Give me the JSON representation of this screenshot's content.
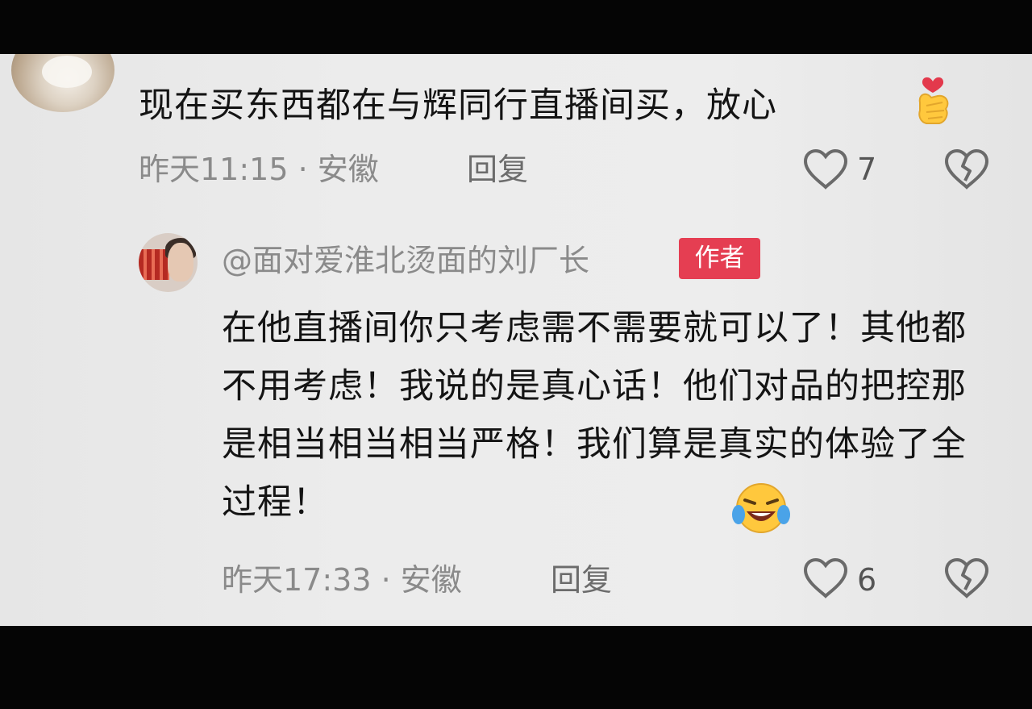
{
  "comments": [
    {
      "text": "现在买东西都在与辉同行直播间买，放心",
      "time_location": "昨天11:15 · 安徽",
      "reply_label": "回复",
      "likes": "7",
      "emoji": "finger-heart-emoji"
    },
    {
      "username": "@面对爱淮北烫面的刘厂长",
      "badge": "作者",
      "text": "在他直播间你只考虑需不需要就可以了！其他都不用考虑！我说的是真心话！他们对品的把控那是相当相当相当严格！我们算是真实的体验了全过程！",
      "time_location": "昨天17:33 · 安徽",
      "reply_label": "回复",
      "likes": "6",
      "emoji": "laughing-crying-emoji"
    }
  ],
  "icons": {
    "like": "heart-outline-icon",
    "dislike": "broken-heart-icon"
  },
  "colors": {
    "badge": "#e53e52",
    "panel": "#ececec",
    "text": "#141414",
    "meta": "#8a8a8a"
  }
}
